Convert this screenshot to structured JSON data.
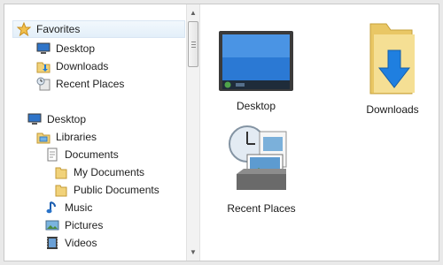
{
  "nav": {
    "favorites": "Favorites",
    "fav_items": [
      "Desktop",
      "Downloads",
      "Recent Places"
    ],
    "desktop": "Desktop",
    "libraries": "Libraries",
    "documents": "Documents",
    "my_documents": "My Documents",
    "public_documents": "Public Documents",
    "music": "Music",
    "pictures": "Pictures",
    "videos": "Videos"
  },
  "content": {
    "tiles": [
      "Desktop",
      "Downloads",
      "Recent Places"
    ]
  },
  "icons": {
    "favorites": "star-icon",
    "desktop": "desktop-icon",
    "downloads": "downloads-icon",
    "recent": "recent-places-icon",
    "libraries": "libraries-icon",
    "documents": "documents-icon",
    "folder": "folder-icon",
    "music": "music-icon",
    "pictures": "pictures-icon",
    "videos": "videos-icon"
  }
}
